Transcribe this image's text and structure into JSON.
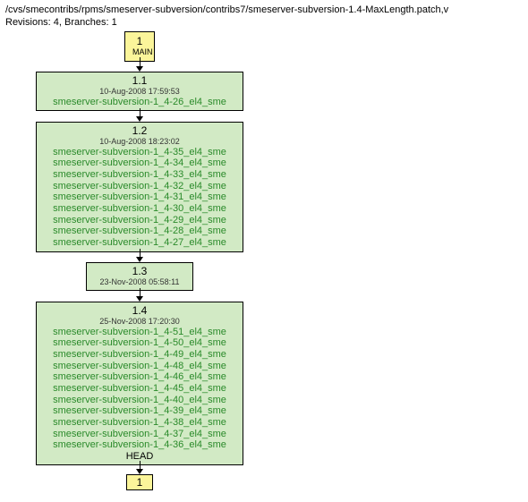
{
  "header": {
    "path": "/cvs/smecontribs/rpms/smeserver-subversion/contribs7/smeserver-subversion-1.4-MaxLength.patch,v",
    "revisions_line": "Revisions: 4, Branches: 1"
  },
  "main_node": {
    "number": "1",
    "label": "MAIN"
  },
  "rev1": {
    "number": "1.1",
    "date": "10-Aug-2008 17:59:53",
    "tags": [
      "smeserver-subversion-1_4-26_el4_sme"
    ]
  },
  "rev2": {
    "number": "1.2",
    "date": "10-Aug-2008 18:23:02",
    "tags": [
      "smeserver-subversion-1_4-35_el4_sme",
      "smeserver-subversion-1_4-34_el4_sme",
      "smeserver-subversion-1_4-33_el4_sme",
      "smeserver-subversion-1_4-32_el4_sme",
      "smeserver-subversion-1_4-31_el4_sme",
      "smeserver-subversion-1_4-30_el4_sme",
      "smeserver-subversion-1_4-29_el4_sme",
      "smeserver-subversion-1_4-28_el4_sme",
      "smeserver-subversion-1_4-27_el4_sme"
    ]
  },
  "rev3": {
    "number": "1.3",
    "date": "23-Nov-2008 05:58:11"
  },
  "rev4": {
    "number": "1.4",
    "date": "25-Nov-2008 17:20:30",
    "tags": [
      "smeserver-subversion-1_4-51_el4_sme",
      "smeserver-subversion-1_4-50_el4_sme",
      "smeserver-subversion-1_4-49_el4_sme",
      "smeserver-subversion-1_4-48_el4_sme",
      "smeserver-subversion-1_4-46_el4_sme",
      "smeserver-subversion-1_4-45_el4_sme",
      "smeserver-subversion-1_4-40_el4_sme",
      "smeserver-subversion-1_4-39_el4_sme",
      "smeserver-subversion-1_4-38_el4_sme",
      "smeserver-subversion-1_4-37_el4_sme",
      "smeserver-subversion-1_4-36_el4_sme"
    ],
    "head": "HEAD"
  },
  "footer_box": {
    "number": "1"
  }
}
